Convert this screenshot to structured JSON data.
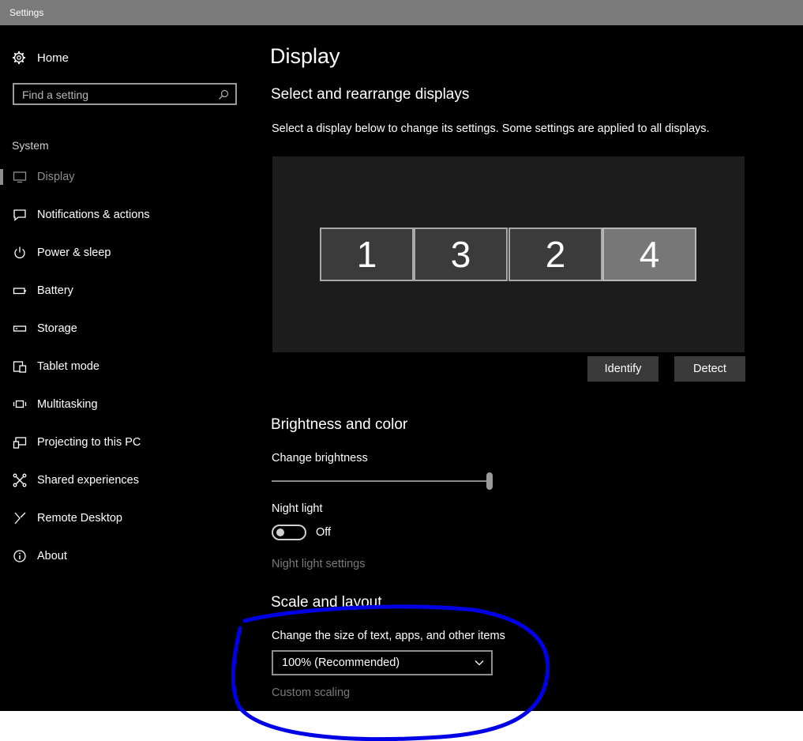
{
  "window": {
    "title": "Settings"
  },
  "sidebar": {
    "home_label": "Home",
    "search_placeholder": "Find a setting",
    "section_label": "System",
    "items": [
      {
        "label": "Display",
        "icon": "monitor-icon",
        "selected": true
      },
      {
        "label": "Notifications & actions",
        "icon": "message-icon"
      },
      {
        "label": "Power & sleep",
        "icon": "power-icon"
      },
      {
        "label": "Battery",
        "icon": "battery-icon"
      },
      {
        "label": "Storage",
        "icon": "storage-icon"
      },
      {
        "label": "Tablet mode",
        "icon": "tablet-icon"
      },
      {
        "label": "Multitasking",
        "icon": "multitasking-icon"
      },
      {
        "label": "Projecting to this PC",
        "icon": "projector-icon"
      },
      {
        "label": "Shared experiences",
        "icon": "share-icon"
      },
      {
        "label": "Remote Desktop",
        "icon": "remote-icon"
      },
      {
        "label": "About",
        "icon": "info-icon"
      }
    ]
  },
  "main": {
    "title": "Display",
    "arrange": {
      "heading": "Select and rearrange displays",
      "description": "Select a display below to change its settings. Some settings are applied to all displays.",
      "monitors": [
        {
          "label": "1",
          "active": false
        },
        {
          "label": "3",
          "active": false
        },
        {
          "label": "2",
          "active": false
        },
        {
          "label": "4",
          "active": true
        }
      ],
      "identify_label": "Identify",
      "detect_label": "Detect"
    },
    "brightness": {
      "heading": "Brightness and color",
      "change_brightness_label": "Change brightness",
      "brightness_level": 1.0,
      "night_light_label": "Night light",
      "night_light_state": "Off",
      "night_light_settings_link": "Night light settings"
    },
    "scale": {
      "heading": "Scale and layout",
      "size_label": "Change the size of text, apps, and other items",
      "size_value": "100% (Recommended)",
      "custom_scaling_link": "Custom scaling"
    }
  },
  "colors": {
    "background": "#000000",
    "titlebar": "#7a7a7a",
    "button": "#3a3a3a",
    "annotation": "#0000e6"
  }
}
